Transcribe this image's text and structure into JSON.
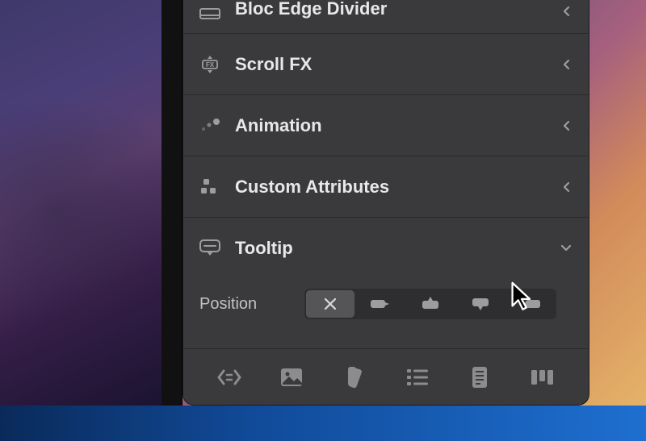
{
  "sections": [
    {
      "label": "Bloc Edge Divider",
      "expanded": false
    },
    {
      "label": "Scroll FX",
      "expanded": false
    },
    {
      "label": "Animation",
      "expanded": false
    },
    {
      "label": "Custom Attributes",
      "expanded": false
    },
    {
      "label": "Tooltip",
      "expanded": true
    }
  ],
  "tooltip": {
    "position_label": "Position",
    "options": [
      "none",
      "left",
      "bottom",
      "top",
      "right"
    ],
    "selected": "none"
  }
}
